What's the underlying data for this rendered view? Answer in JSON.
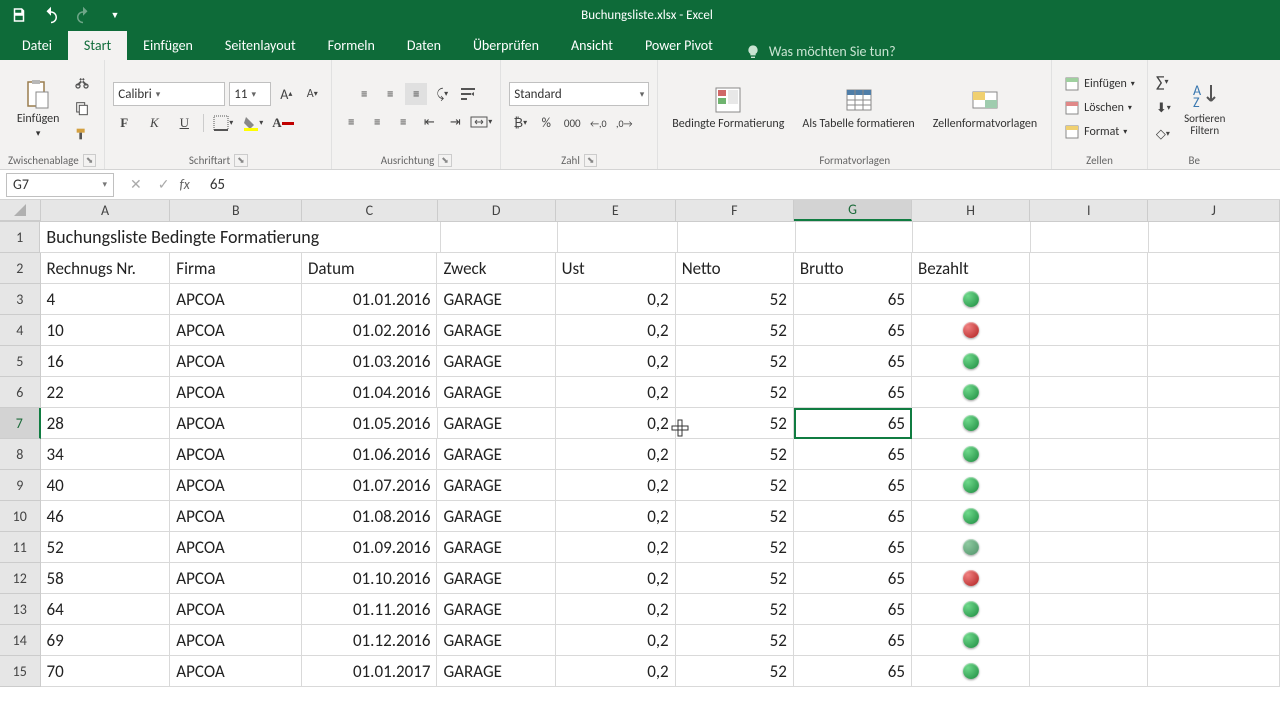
{
  "app": {
    "title": "Buchungsliste.xlsx - Excel"
  },
  "tabs": {
    "file": "Datei",
    "start": "Start",
    "insert": "Einfügen",
    "pagelayout": "Seitenlayout",
    "formulas": "Formeln",
    "data": "Daten",
    "review": "Überprüfen",
    "view": "Ansicht",
    "powerpivot": "Power Pivot",
    "tellme": "Was möchten Sie tun?"
  },
  "ribbon": {
    "clipboard": {
      "label": "Zwischenablage",
      "paste": "Einfügen"
    },
    "font": {
      "label": "Schriftart",
      "name": "Calibri",
      "size": "11"
    },
    "alignment": {
      "label": "Ausrichtung"
    },
    "number": {
      "label": "Zahl",
      "format": "Standard"
    },
    "styles": {
      "label": "Formatvorlagen",
      "cond": "Bedingte Formatierung",
      "table": "Als Tabelle formatieren",
      "cell": "Zellenformatvorlagen"
    },
    "cells": {
      "label": "Zellen",
      "insert": "Einfügen",
      "delete": "Löschen",
      "format": "Format"
    },
    "editing": {
      "sort": "Sortieren Filtern",
      "be": "Be"
    }
  },
  "formulabar": {
    "cellref": "G7",
    "value": "65"
  },
  "columns": [
    "A",
    "B",
    "C",
    "D",
    "E",
    "F",
    "G",
    "H",
    "I",
    "J"
  ],
  "headers": {
    "title": "Buchungsliste Bedingte Formatierung",
    "a": "Rechnugs Nr.",
    "b": "Firma",
    "c": "Datum",
    "d": "Zweck",
    "e": "Ust",
    "f": "Netto",
    "g": "Brutto",
    "h": "Bezahlt"
  },
  "rows": [
    {
      "n": 3,
      "a": "4",
      "b": "APCOA",
      "c": "01.01.2016",
      "d": "GARAGE",
      "e": "0,2",
      "f": "52",
      "g": "65",
      "h": "green"
    },
    {
      "n": 4,
      "a": "10",
      "b": "APCOA",
      "c": "01.02.2016",
      "d": "GARAGE",
      "e": "0,2",
      "f": "52",
      "g": "65",
      "h": "red"
    },
    {
      "n": 5,
      "a": "16",
      "b": "APCOA",
      "c": "01.03.2016",
      "d": "GARAGE",
      "e": "0,2",
      "f": "52",
      "g": "65",
      "h": "green"
    },
    {
      "n": 6,
      "a": "22",
      "b": "APCOA",
      "c": "01.04.2016",
      "d": "GARAGE",
      "e": "0,2",
      "f": "52",
      "g": "65",
      "h": "green"
    },
    {
      "n": 7,
      "a": "28",
      "b": "APCOA",
      "c": "01.05.2016",
      "d": "GARAGE",
      "e": "0,2",
      "f": "52",
      "g": "65",
      "h": "green"
    },
    {
      "n": 8,
      "a": "34",
      "b": "APCOA",
      "c": "01.06.2016",
      "d": "GARAGE",
      "e": "0,2",
      "f": "52",
      "g": "65",
      "h": "green"
    },
    {
      "n": 9,
      "a": "40",
      "b": "APCOA",
      "c": "01.07.2016",
      "d": "GARAGE",
      "e": "0,2",
      "f": "52",
      "g": "65",
      "h": "green"
    },
    {
      "n": 10,
      "a": "46",
      "b": "APCOA",
      "c": "01.08.2016",
      "d": "GARAGE",
      "e": "0,2",
      "f": "52",
      "g": "65",
      "h": "green"
    },
    {
      "n": 11,
      "a": "52",
      "b": "APCOA",
      "c": "01.09.2016",
      "d": "GARAGE",
      "e": "0,2",
      "f": "52",
      "g": "65",
      "h": "muted-green"
    },
    {
      "n": 12,
      "a": "58",
      "b": "APCOA",
      "c": "01.10.2016",
      "d": "GARAGE",
      "e": "0,2",
      "f": "52",
      "g": "65",
      "h": "red"
    },
    {
      "n": 13,
      "a": "64",
      "b": "APCOA",
      "c": "01.11.2016",
      "d": "GARAGE",
      "e": "0,2",
      "f": "52",
      "g": "65",
      "h": "green"
    },
    {
      "n": 14,
      "a": "69",
      "b": "APCOA",
      "c": "01.12.2016",
      "d": "GARAGE",
      "e": "0,2",
      "f": "52",
      "g": "65",
      "h": "green"
    },
    {
      "n": 15,
      "a": "70",
      "b": "APCOA",
      "c": "01.01.2017",
      "d": "GARAGE",
      "e": "0,2",
      "f": "52",
      "g": "65",
      "h": "green"
    }
  ],
  "selectedCell": "G7",
  "selectedRow": 7
}
